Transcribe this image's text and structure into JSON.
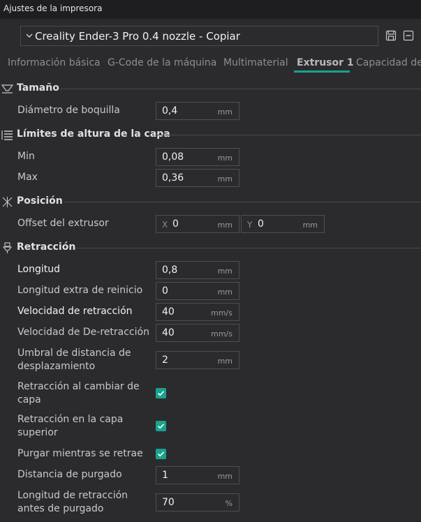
{
  "window": {
    "title": "Ajustes de la impresora"
  },
  "preset": {
    "name": "Creality Ender-3 Pro 0.4 nozzle - Copiar"
  },
  "tabs": [
    {
      "label": "Información básica"
    },
    {
      "label": "G-Code de la máquina"
    },
    {
      "label": "Multimaterial"
    },
    {
      "label": "Extrusor 1"
    },
    {
      "label": "Capacidad de"
    }
  ],
  "active_tab": "Extrusor 1",
  "accent_color": "#19a28c",
  "sections": {
    "size": {
      "title": "Tamaño",
      "nozzle_diameter": {
        "label": "Diámetro de boquilla",
        "value": "0,4",
        "unit": "mm"
      }
    },
    "layer_height": {
      "title": "Límites de altura de la capa",
      "min": {
        "label": "Min",
        "value": "0,08",
        "unit": "mm"
      },
      "max": {
        "label": "Max",
        "value": "0,36",
        "unit": "mm"
      }
    },
    "position": {
      "title": "Posición",
      "offset": {
        "label": "Offset del extrusor",
        "x_axis": "X",
        "x_value": "0",
        "y_axis": "Y",
        "y_value": "0",
        "unit": "mm"
      }
    },
    "retraction": {
      "title": "Retracción",
      "length": {
        "label": "Longitud",
        "value": "0,8",
        "unit": "mm"
      },
      "restart_extra": {
        "label": "Longitud extra de reinicio",
        "value": "0",
        "unit": "mm"
      },
      "speed": {
        "label": "Velocidad de retracción",
        "value": "40",
        "unit": "mm/s"
      },
      "deretraction_speed": {
        "label": "Velocidad de De-retracción",
        "value": "40",
        "unit": "mm/s"
      },
      "travel_threshold": {
        "label_line1": "Umbral de distancia de",
        "label_line2": "desplazamiento",
        "value": "2",
        "unit": "mm"
      },
      "on_layer_change": {
        "label_line1": "Retracción al cambiar de",
        "label_line2": "capa",
        "checked": true
      },
      "top_layer": {
        "label_line1": "Retracción en la capa",
        "label_line2": "superior",
        "checked": true
      },
      "wipe": {
        "label": "Purgar mientras se retrae",
        "checked": true
      },
      "wipe_distance": {
        "label": "Distancia de purgado",
        "value": "1",
        "unit": "mm"
      },
      "retract_before_wipe": {
        "label_line1": "Longitud de retracción",
        "label_line2": "antes de purgado",
        "value": "70",
        "unit": "%"
      }
    }
  }
}
